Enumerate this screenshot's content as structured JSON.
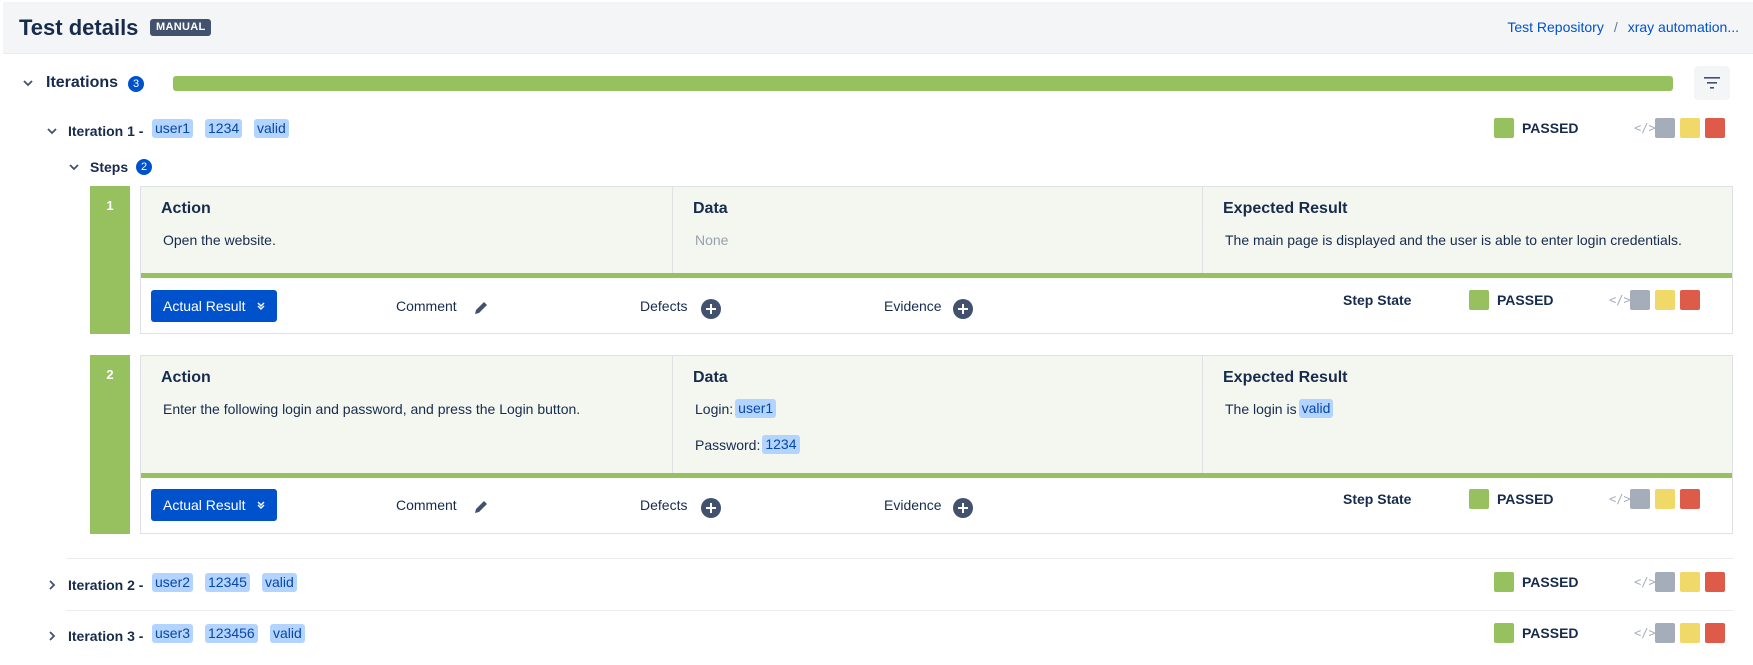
{
  "header": {
    "title": "Test details",
    "badge": "MANUAL",
    "breadcrumb": [
      {
        "label": "Test Repository"
      },
      {
        "label": "xray automation..."
      }
    ],
    "breadcrumb_separator": "/"
  },
  "iterations": {
    "label": "Iterations",
    "count": "3",
    "progress_passed_percent": 100,
    "progress_color": "#97c05f",
    "items": [
      {
        "title": "Iteration 1 -",
        "params": [
          "user1",
          "1234",
          "valid"
        ],
        "status": "PASSED",
        "expanded": true,
        "steps": {
          "label": "Steps",
          "count": "2",
          "list": [
            {
              "number": "1",
              "action_header": "Action",
              "action_text": "Open the website.",
              "data_header": "Data",
              "data_text": "None",
              "expected_header": "Expected Result",
              "expected_text": "The main page is displayed and the user is able to enter login credentials.",
              "actual_result_label": "Actual Result",
              "comment_label": "Comment",
              "defects_label": "Defects",
              "evidence_label": "Evidence",
              "step_state_label": "Step State",
              "status": "PASSED"
            },
            {
              "number": "2",
              "action_header": "Action",
              "action_text": "Enter the following login and password, and press the Login button.",
              "data_header": "Data",
              "data_login_label": "Login:",
              "data_login_value": "user1",
              "data_password_label": "Password:",
              "data_password_value": "1234",
              "expected_header": "Expected Result",
              "expected_text": "The login is",
              "expected_value": "valid",
              "actual_result_label": "Actual Result",
              "comment_label": "Comment",
              "defects_label": "Defects",
              "evidence_label": "Evidence",
              "step_state_label": "Step State",
              "status": "PASSED"
            }
          ]
        }
      },
      {
        "title": "Iteration 2 -",
        "params": [
          "user2",
          "12345",
          "valid"
        ],
        "status": "PASSED",
        "expanded": false
      },
      {
        "title": "Iteration 3 -",
        "params": [
          "user3",
          "123456",
          "valid"
        ],
        "status": "PASSED",
        "expanded": false
      }
    ]
  },
  "quick_status": {
    "code_glyph": "</>",
    "colors": [
      "#a5adba",
      "#f0d969",
      "#de5b4a"
    ]
  },
  "colors": {
    "passed": "#97c05f",
    "primary": "#0052cc",
    "tag_bg": "#b3d4ff"
  },
  "icons": {
    "chevron_down": "chevron-down-icon",
    "chevron_right": "chevron-right-icon",
    "filter": "filter-icon",
    "edit": "pencil-icon",
    "add": "plus-circle-icon",
    "code": "code-icon"
  }
}
